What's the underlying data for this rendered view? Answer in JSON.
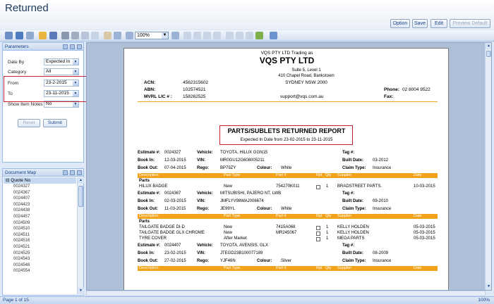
{
  "window": {
    "title": "Returned"
  },
  "header_buttons": [
    {
      "label": "Option",
      "enabled": true
    },
    {
      "label": "Save",
      "enabled": true
    },
    {
      "label": "Edit",
      "enabled": true
    },
    {
      "label": "Preview Default",
      "enabled": false
    }
  ],
  "toolbar": {
    "zoom": "100%"
  },
  "parameters": {
    "title": "Parameters",
    "fields": [
      {
        "label": "Date By",
        "value": "Expected In"
      },
      {
        "label": "Category",
        "value": "All"
      },
      {
        "label": "From",
        "value": "23-2-2015"
      },
      {
        "label": "To",
        "value": "23-11-2015"
      },
      {
        "label": "Show Item Notes",
        "value": "No"
      }
    ],
    "reset_label": "Reset",
    "submit_label": "Submit"
  },
  "document_map": {
    "title": "Document Map",
    "root": "Quote No",
    "items": [
      "0024327",
      "0024367",
      "0024407",
      "0024423",
      "0024438",
      "0024457",
      "0024509",
      "0024510",
      "0024511",
      "0024516",
      "0024521",
      "0024525",
      "0024543",
      "0024548",
      "0024554"
    ]
  },
  "report": {
    "company_line": "VQS PTY LTD Trading as",
    "company_name": "VQS PTY LTD",
    "addr1": "Suite 5, Level 1",
    "addr2": "410 Chapel Road, Bankstown",
    "addr3": "SYDNEY NSW 2000",
    "acn_label": "ACN:",
    "acn": "4562315602",
    "abn_label": "ABN:",
    "abn": "102574521",
    "mvrl_label": "MVRL LIC # :",
    "mvrl": "158262525",
    "email": "support@vqs.com.au",
    "phone_label": "Phone:",
    "phone": "02 8004 9522",
    "fax_label": "Fax:",
    "report_title": "PARTS/SUBLETS RETURNED REPORT",
    "report_subtitle": "Expected In Date from 23-02-2015 to 23-11-2015",
    "labels": {
      "estimate": "Estimate #:",
      "vehicle": "Vehicle:",
      "tag": "Tag #:",
      "book_in": "Book In:",
      "vin": "VIN:",
      "built_date": "Built Date:",
      "book_out": "Book Out:",
      "rego": "Rego:",
      "colour": "Colour:",
      "claim_type": "Claim Type:"
    },
    "columns": {
      "description": "Description",
      "part_type": "Part Type",
      "part_no": "Part #",
      "rpt": "Rpt",
      "qty": "Qty",
      "supplier": "Supplier",
      "date": "Date"
    },
    "parts_label": "Parts",
    "estimates": [
      {
        "estimate": "0024327",
        "vehicle": "TOYOTA, HILUX GGN15",
        "book_in": "12-03-2015",
        "vin": "MR0GU12G608005211",
        "built_date": "03-2012",
        "book_out": "07-04-2015",
        "rego": "BP79ZY",
        "colour": "White",
        "claim_type": "Insurance",
        "rows": [
          {
            "description": "HILUX BADGE",
            "part_type": "New",
            "part_no": "754270K011",
            "qty": "1",
            "supplier": "BRADSTREET PARTS.",
            "date": "10-03-2015"
          }
        ]
      },
      {
        "estimate": "0024367",
        "vehicle": "MITSUBISHI, PAJERO NT, LWB",
        "book_in": "02-03-2015",
        "vin": "JMFLYV98WAJ006674",
        "built_date": "09-2010",
        "book_out": "11-03-2015",
        "rego": "JE99YL",
        "colour": "White",
        "claim_type": "Insurance",
        "rows": [
          {
            "description": "TAILGATE BADGE DI-D",
            "part_type": "New",
            "part_no": "7415A068",
            "qty": "1",
            "supplier": "KELLY HOLDEN",
            "date": "05-03-2015"
          },
          {
            "description": "TAILGATE BADGE GLX CHROME",
            "part_type": "New",
            "part_no": "MR245067",
            "qty": "1",
            "supplier": "KELLY HOLDEN",
            "date": "05-03-2015"
          },
          {
            "description": "TYRE COVER",
            "part_type": "After Market",
            "part_no": "",
            "qty": "1",
            "supplier": "MEGA PARTS",
            "date": "05-03-2015"
          }
        ]
      },
      {
        "estimate": "0024407",
        "vehicle": "TOYOTA, AVENSIS, GLX",
        "book_in": "23-02-2015",
        "vin": "JTEGD23B100077189",
        "built_date": "08-2009",
        "book_out": "27-02-2015",
        "rego": "YJF46N",
        "colour": "Silver",
        "claim_type": "Insurance",
        "rows": []
      }
    ]
  },
  "status": {
    "page": "Page 1 of 15",
    "zoom": "100%"
  }
}
